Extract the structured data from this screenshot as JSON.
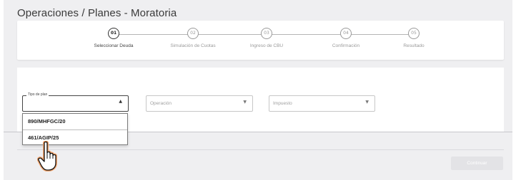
{
  "page": {
    "title": "Operaciones / Planes - Moratoria"
  },
  "stepper": {
    "steps": [
      {
        "number": "01",
        "label": "Seleccionar Deuda",
        "active": true
      },
      {
        "number": "02",
        "label": "Simulación de Cuotas",
        "active": false
      },
      {
        "number": "03",
        "label": "Ingreso de CBU",
        "active": false
      },
      {
        "number": "04",
        "label": "Confirmación",
        "active": false
      },
      {
        "number": "05",
        "label": "Resultado",
        "active": false
      }
    ]
  },
  "form": {
    "tipo_plan": {
      "label": "Tipo de plan",
      "value": "",
      "open": true
    },
    "operacion": {
      "placeholder": "Operación"
    },
    "impuesto": {
      "placeholder": "Impuesto"
    },
    "tipo_plan_options": [
      "890/MHFGC/20",
      "461/AGIP/25"
    ]
  },
  "actions": {
    "continue_label": "Continuar"
  },
  "colors": {
    "background": "#efeff1",
    "card": "#ffffff",
    "button_disabled": "#e3e3e6",
    "cursor_fill": "#ffffff",
    "cursor_glow": "#f3a46b"
  },
  "icons": {
    "dropdown_caret": "caret-icon",
    "pointer": "hand-pointer-icon"
  }
}
